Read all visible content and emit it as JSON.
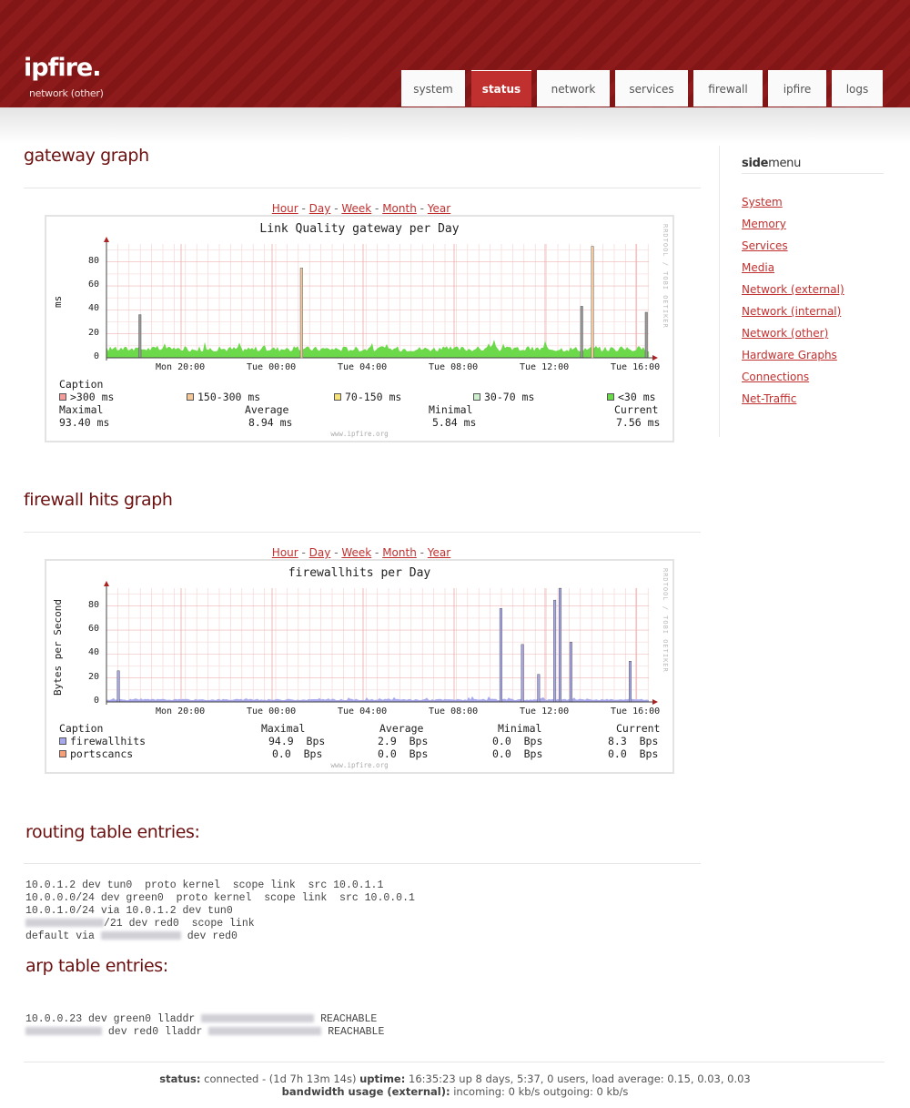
{
  "logo": {
    "name": "ipfire.",
    "subtitle": "network (other)"
  },
  "tabs": [
    {
      "label": "system",
      "active": false
    },
    {
      "label": "status",
      "active": true
    },
    {
      "label": "network",
      "active": false
    },
    {
      "label": "services",
      "active": false
    },
    {
      "label": "firewall",
      "active": false
    },
    {
      "label": "ipfire",
      "active": false
    },
    {
      "label": "logs",
      "active": false
    }
  ],
  "nav": {
    "hour": "Hour",
    "day": "Day",
    "week": "Week",
    "month": "Month",
    "year": "Year",
    "sep": " - "
  },
  "gateway": {
    "heading": "gateway graph",
    "chart_title": "Link Quality gateway per Day",
    "ylabel": "ms",
    "yticks": [
      "0",
      "20",
      "40",
      "60",
      "80"
    ],
    "xticks": [
      "Mon 20:00",
      "Tue 00:00",
      "Tue 04:00",
      "Tue 08:00",
      "Tue 12:00",
      "Tue 16:00"
    ],
    "side_text": "RRDTOOL / TOBI OETIKER",
    "footer": "www.ipfire.org",
    "caption": "Caption",
    "legend": [
      ">300 ms",
      "150-300 ms",
      "70-150 ms",
      "30-70 ms",
      "<30 ms"
    ],
    "stats_labels": [
      "Maximal",
      "Average",
      "Minimal",
      "Current"
    ],
    "stats_values": [
      "93.40 ms",
      "8.94 ms",
      "5.84 ms",
      "7.56 ms"
    ]
  },
  "firewall": {
    "heading": "firewall hits graph",
    "chart_title": "firewallhits per Day",
    "ylabel": "Bytes per Second",
    "yticks": [
      "0",
      "20",
      "40",
      "60",
      "80"
    ],
    "xticks": [
      "Mon 20:00",
      "Tue 00:00",
      "Tue 04:00",
      "Tue 08:00",
      "Tue 12:00",
      "Tue 16:00"
    ],
    "side_text": "RRDTOOL / TOBI OETIKER",
    "footer": "www.ipfire.org",
    "caption": "Caption",
    "cols": [
      "Maximal",
      "Average",
      "Minimal",
      "Current"
    ],
    "rows": [
      {
        "name": "firewallhits",
        "values": [
          "94.9  Bps",
          "2.9  Bps",
          "0.0  Bps",
          "8.3  Bps"
        ]
      },
      {
        "name": "portscancs",
        "values": [
          "0.0  Bps",
          "0.0  Bps",
          "0.0  Bps",
          "0.0  Bps"
        ]
      }
    ]
  },
  "routing": {
    "heading": "routing table entries:",
    "lines": [
      "10.0.1.2 dev tun0  proto kernel  scope link  src 10.0.1.1",
      "10.0.0.0/24 dev green0  proto kernel  scope link  src 10.0.0.1",
      "10.0.1.0/24 via 10.0.1.2 dev tun0",
      "/21 dev red0  scope link",
      "default via ",
      " dev red0"
    ]
  },
  "arp": {
    "heading": "arp table entries:",
    "line1_a": "10.0.0.23 dev green0 lladdr ",
    "line1_b": " REACHABLE",
    "line2_a": " dev red0 lladdr ",
    "line2_b": " REACHABLE"
  },
  "sidemenu": {
    "title_bold": "side",
    "title_rest": "menu",
    "items": [
      "System",
      "Memory",
      "Services",
      "Media",
      "Network (external)",
      "Network (internal)",
      "Network (other)",
      "Hardware Graphs",
      "Connections",
      "Net-Traffic"
    ]
  },
  "footer": {
    "status_label": "status:",
    "status_value": " connected - (1d 7h 13m 14s) ",
    "uptime_label": "uptime:",
    "uptime_value": " 16:35:23 up 8 days, 5:37, 0 users, load average: 0.15, 0.03, 0.03",
    "bw_label": "bandwidth usage (external):",
    "bw_value": " incoming: 0 kb/s outgoing: 0 kb/s"
  },
  "chart_data": [
    {
      "type": "area",
      "title": "Link Quality gateway per Day",
      "ylabel": "ms",
      "ylim": [
        0,
        95
      ],
      "x_labels": [
        "Mon 20:00",
        "Tue 00:00",
        "Tue 04:00",
        "Tue 08:00",
        "Tue 12:00",
        "Tue 16:00"
      ],
      "series": [
        {
          "name": "<30 ms",
          "color": "#6cd94a",
          "baseline": 7.5,
          "spikes": [
            [
              0.06,
              36
            ],
            [
              0.36,
              75
            ],
            [
              0.88,
              43
            ],
            [
              0.9,
              93
            ],
            [
              1.0,
              38
            ]
          ]
        }
      ],
      "legend_colors": [
        "#f29c9c",
        "#f5c89a",
        "#f5e27a",
        "#cdeecd",
        "#6cd94a"
      ]
    },
    {
      "type": "area",
      "title": "firewallhits per Day",
      "ylabel": "Bytes per Second",
      "ylim": [
        0,
        95
      ],
      "x_labels": [
        "Mon 20:00",
        "Tue 00:00",
        "Tue 04:00",
        "Tue 08:00",
        "Tue 12:00",
        "Tue 16:00"
      ],
      "series": [
        {
          "name": "firewallhits",
          "color": "#a7a7ee",
          "baseline": 2,
          "spikes": [
            [
              0.02,
              26
            ],
            [
              0.73,
              78
            ],
            [
              0.77,
              48
            ],
            [
              0.8,
              23
            ],
            [
              0.83,
              85
            ],
            [
              0.84,
              94.9
            ],
            [
              0.86,
              50
            ],
            [
              0.97,
              34
            ]
          ]
        },
        {
          "name": "portscancs",
          "color": "#f5a07a"
        }
      ]
    }
  ]
}
